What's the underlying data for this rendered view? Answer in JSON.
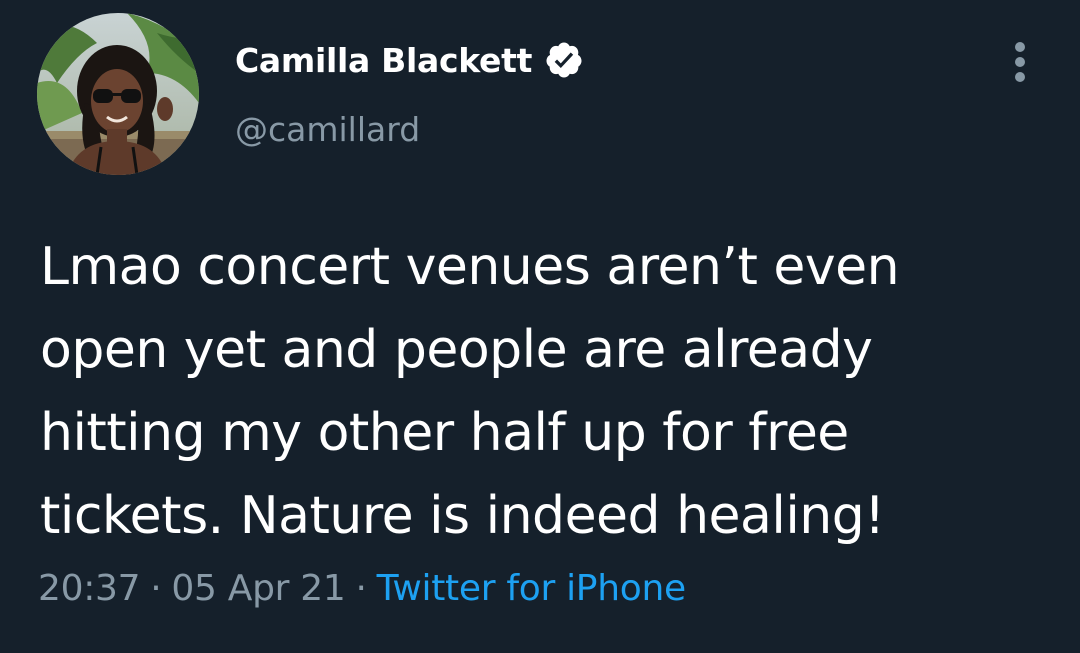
{
  "tweet": {
    "author": {
      "display_name": "Camilla Blackett",
      "handle": "@camillard",
      "verified": true
    },
    "text_lines": [
      "Lmao concert venues aren’t even",
      "open yet and people are already",
      "hitting my other half up for free",
      "tickets. Nature is indeed healing!"
    ],
    "time": "20:37",
    "separator": "·",
    "date": "05 Apr 21",
    "source": "Twitter for iPhone"
  },
  "icons": {
    "verified": "verified-badge-icon",
    "more": "more-vertical-icon"
  },
  "colors": {
    "background": "#15202b",
    "primary_text": "#ffffff",
    "secondary_text": "#8899a6",
    "link": "#1da1f2"
  }
}
